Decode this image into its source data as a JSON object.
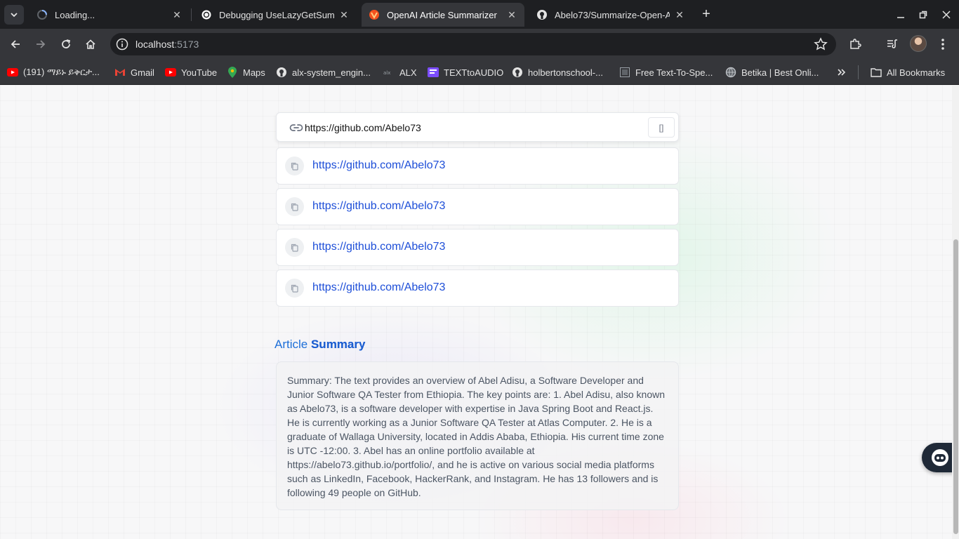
{
  "browser": {
    "tabs": [
      {
        "title": "Loading...",
        "icon": "loading-spinner-icon",
        "active": false
      },
      {
        "title": "Debugging UseLazyGetSumm",
        "icon": "openai-icon",
        "active": false
      },
      {
        "title": "OpenAI Article Summarizer",
        "icon": "vite-icon",
        "active": true
      },
      {
        "title": "Abelo73/Summarize-Open-A",
        "icon": "github-icon",
        "active": false
      }
    ],
    "url_host": "localhost",
    "url_port": ":5173",
    "bookmarks": [
      {
        "label": "(191) ማይኑ ይቅርታ...",
        "icon": "youtube-icon"
      },
      {
        "label": "Gmail",
        "icon": "gmail-icon"
      },
      {
        "label": "YouTube",
        "icon": "youtube-icon"
      },
      {
        "label": "Maps",
        "icon": "maps-icon"
      },
      {
        "label": "alx-system_engin...",
        "icon": "github-icon"
      },
      {
        "label": "ALX",
        "icon": "alx-icon"
      },
      {
        "label": "TEXTtoAUDIO",
        "icon": "texttoaudio-icon"
      },
      {
        "label": "holbertonschool-...",
        "icon": "github-icon"
      },
      {
        "label": "Free Text-To-Spe...",
        "icon": "tts-icon"
      },
      {
        "label": "Betika | Best Onli...",
        "icon": "globe-icon"
      }
    ],
    "all_bookmarks_label": "All Bookmarks"
  },
  "form": {
    "url_value": "https://github.com/Abelo73",
    "submit_label": "[]"
  },
  "history": [
    {
      "url": "https://github.com/Abelo73"
    },
    {
      "url": "https://github.com/Abelo73"
    },
    {
      "url": "https://github.com/Abelo73"
    },
    {
      "url": "https://github.com/Abelo73"
    }
  ],
  "summary": {
    "heading_plain": "Article",
    "heading_bold": "Summary",
    "text": "Summary: The text provides an overview of Abel Adisu, a Software Developer and Junior Software QA Tester from Ethiopia. The key points are: 1. Abel Adisu, also known as Abelo73, is a software developer with expertise in Java Spring Boot and React.js. He is currently working as a Junior Software QA Tester at Atlas Computer. 2. He is a graduate of Wallaga University, located in Addis Ababa, Ethiopia. His current time zone is UTC -12:00. 3. Abel has an online portfolio available at https://abelo73.github.io/portfolio/, and he is active on various social media platforms such as LinkedIn, Facebook, HackerRank, and Instagram. He has 13 followers and is following 49 people on GitHub."
  },
  "colors": {
    "accent": "#1d5fd0",
    "link": "#1d4ed8",
    "chrome_dark": "#1e1f22",
    "chrome": "#35363a"
  }
}
